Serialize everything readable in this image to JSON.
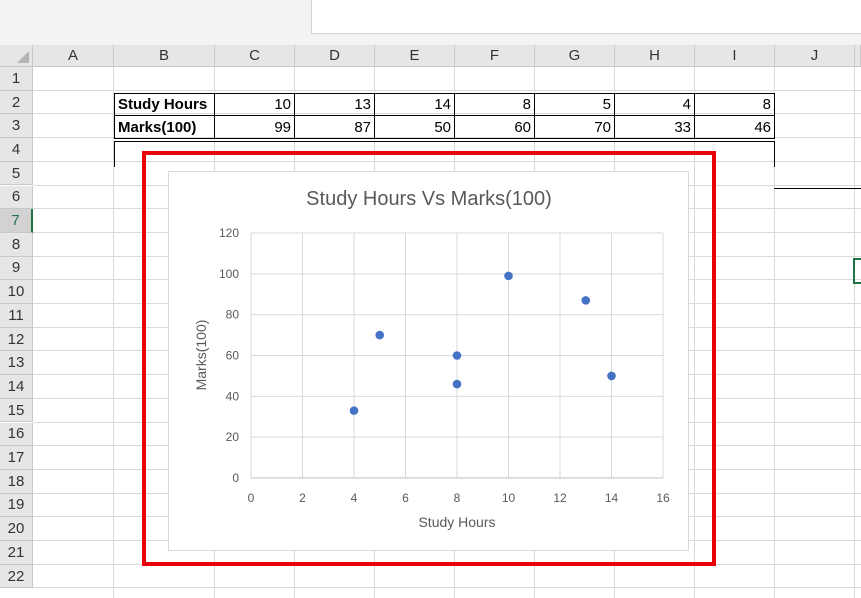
{
  "columns": [
    "A",
    "B",
    "C",
    "D",
    "E",
    "F",
    "G",
    "H",
    "I",
    "J"
  ],
  "rows": [
    "1",
    "2",
    "3",
    "4",
    "5",
    "6",
    "7",
    "8",
    "9",
    "10",
    "11",
    "12",
    "13",
    "14",
    "15",
    "16",
    "17",
    "18",
    "19",
    "20",
    "21",
    "22"
  ],
  "selected_row": "7",
  "table": {
    "row1_label": "Study Hours",
    "row1_values": [
      "10",
      "13",
      "14",
      "8",
      "5",
      "4",
      "8"
    ],
    "row2_label": "Marks(100)",
    "row2_values": [
      "99",
      "87",
      "50",
      "60",
      "70",
      "33",
      "46"
    ]
  },
  "chart_data": {
    "type": "scatter",
    "title": "Study Hours Vs Marks(100)",
    "xlabel": "Study Hours",
    "ylabel": "Marks(100)",
    "xlim": [
      0,
      16
    ],
    "ylim": [
      0,
      120
    ],
    "xticks": [
      "0",
      "2",
      "4",
      "6",
      "8",
      "10",
      "12",
      "14",
      "16"
    ],
    "yticks": [
      "0",
      "20",
      "40",
      "60",
      "80",
      "100",
      "120"
    ],
    "grid": true,
    "series": [
      {
        "x": [
          10,
          13,
          14,
          8,
          5,
          4,
          8
        ],
        "y": [
          99,
          87,
          50,
          60,
          70,
          33,
          46
        ],
        "color": "#4472c4"
      }
    ]
  },
  "colors": {
    "highlight": "#e8000b",
    "excel_green": "#217346",
    "marker": "#4472c4"
  }
}
